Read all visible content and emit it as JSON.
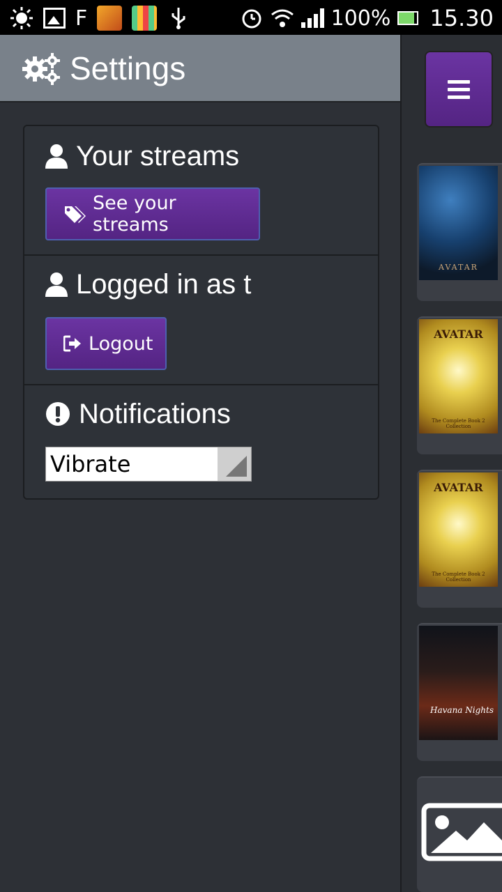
{
  "status_bar": {
    "notif_letter": "F",
    "battery": "100%",
    "time": "15.30"
  },
  "panel": {
    "title": "Settings",
    "sections": {
      "streams": {
        "heading": "Your streams",
        "button": "See your streams"
      },
      "account": {
        "heading": "Logged in as t",
        "button": "Logout"
      },
      "notifications": {
        "heading": "Notifications",
        "selected": "Vibrate"
      }
    }
  },
  "right": {
    "posters": [
      {
        "name": "avatar",
        "caption": "AVATAR"
      },
      {
        "name": "avatar-book2",
        "caption": "AVATAR",
        "subcaption": "The Complete Book 2 Collection"
      },
      {
        "name": "avatar-book2-b",
        "caption": "AVATAR",
        "subcaption": "The Complete Book 2 Collection"
      },
      {
        "name": "havana-nights",
        "caption": "Havana Nights"
      }
    ]
  },
  "colors": {
    "accent": "#5e2c92",
    "header_bg": "#79818a",
    "panel_bg": "#2d3036"
  }
}
